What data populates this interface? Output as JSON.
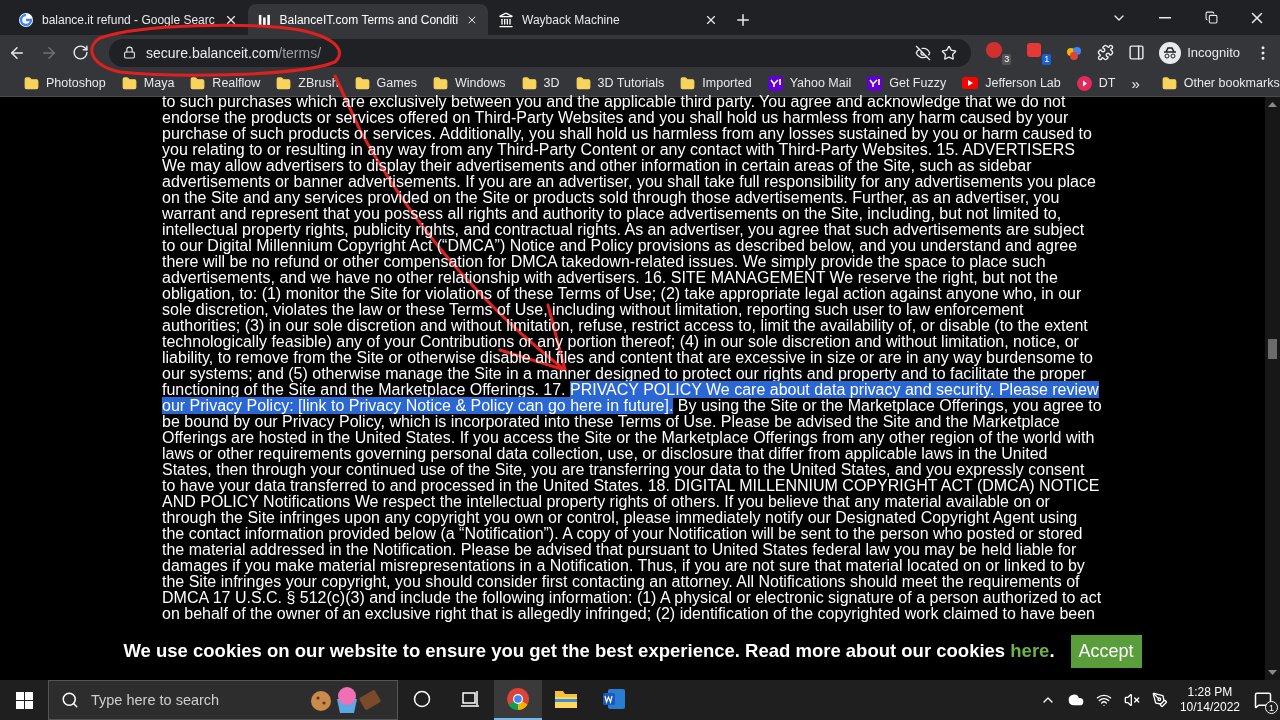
{
  "tabs": [
    {
      "title": "balance.it refund - Google Searc",
      "kind": "google",
      "selected": false
    },
    {
      "title": "BalanceIT.com Terms and Conditi",
      "kind": "bars",
      "selected": true
    },
    {
      "title": "Wayback Machine",
      "kind": "landmark",
      "selected": false
    }
  ],
  "toolbar": {
    "forward_disabled": true,
    "address_host": "secure.balanceit.com",
    "address_path": "/terms/",
    "extension_badges": [
      "3",
      "1"
    ],
    "profile": "Incognito"
  },
  "bookmarks": [
    {
      "label": "Photoshop",
      "kind": "folder"
    },
    {
      "label": "Maya",
      "kind": "folder"
    },
    {
      "label": "Realflow",
      "kind": "folder"
    },
    {
      "label": "ZBrush",
      "kind": "folder"
    },
    {
      "label": "Games",
      "kind": "folder"
    },
    {
      "label": "Windows",
      "kind": "folder"
    },
    {
      "label": "3D",
      "kind": "folder"
    },
    {
      "label": "3D Tutorials",
      "kind": "folder"
    },
    {
      "label": "Imported",
      "kind": "folder"
    },
    {
      "label": "Yahoo Mail",
      "kind": "yahoo"
    },
    {
      "label": "Get Fuzzy",
      "kind": "yahoo"
    },
    {
      "label": "Jefferson Lab",
      "kind": "video"
    },
    {
      "label": "DT",
      "kind": "play"
    }
  ],
  "bookmarks_overflow": "»",
  "other_bookmarks": "Other bookmarks",
  "page_lines": [
    [
      {
        "text": "to such purchases which are exclusively between you and the applicable third party. You agree and acknowledge that we do not",
        "selected": false
      }
    ],
    [
      {
        "text": "endorse the products or services offered on Third-Party Websites and you shall hold us harmless from any harm caused by your",
        "selected": false
      }
    ],
    [
      {
        "text": "purchase of such products or services. Additionally, you shall hold us harmless from any losses sustained by you or harm caused to",
        "selected": false
      }
    ],
    [
      {
        "text": "you relating to or resulting in any way from any Third-Party Content or any contact with Third-Party Websites. 15. ADVERTISERS",
        "selected": false
      }
    ],
    [
      {
        "text": "We may allow advertisers to display their advertisements and other information in certain areas of the Site, such as sidebar",
        "selected": false
      }
    ],
    [
      {
        "text": "advertisements or banner advertisements. If you are an advertiser, you shall take full responsibility for any advertisements you place",
        "selected": false
      }
    ],
    [
      {
        "text": "on the Site and any services provided on the Site or products sold through those advertisements. Further, as an advertiser, you",
        "selected": false
      }
    ],
    [
      {
        "text": "warrant and represent that you possess all rights and authority to place advertisements on the Site, including, but not limited to,",
        "selected": false
      }
    ],
    [
      {
        "text": "intellectual property rights, publicity rights, and contractual rights. As an advertiser, you agree that such advertisements are subject",
        "selected": false
      }
    ],
    [
      {
        "text": "to our Digital Millennium Copyright Act (“DMCA”) Notice and Policy provisions as described below, and you understand and agree",
        "selected": false
      }
    ],
    [
      {
        "text": "there will be no refund or other compensation for DMCA takedown-related issues. We simply provide the space to place such",
        "selected": false
      }
    ],
    [
      {
        "text": "advertisements, and we have no other relationship with advertisers. 16. SITE MANAGEMENT We reserve the right, but not the",
        "selected": false
      }
    ],
    [
      {
        "text": "obligation, to: (1) monitor the Site for violations of these Terms of Use; (2) take appropriate legal action against anyone who, in our",
        "selected": false
      }
    ],
    [
      {
        "text": "sole discretion, violates the law or these Terms of Use, including without limitation, reporting such user to law enforcement",
        "selected": false
      }
    ],
    [
      {
        "text": "authorities; (3) in our sole discretion and without limitation, refuse, restrict access to, limit the availability of, or disable (to the extent",
        "selected": false
      }
    ],
    [
      {
        "text": "technologically feasible) any of your Contributions or any portion thereof; (4) in our sole discretion and without limitation, notice, or",
        "selected": false
      }
    ],
    [
      {
        "text": "liability, to remove from the Site or otherwise disable all files and content that are excessive in size or are in any way burdensome to",
        "selected": false
      }
    ],
    [
      {
        "text": "our systems; and (5) otherwise manage the Site in a manner designed to protect our rights and property and to facilitate the proper",
        "selected": false
      }
    ],
    [
      {
        "text": "functioning of the Site and the Marketplace Offerings. 17. ",
        "selected": false
      },
      {
        "text": "PRIVACY POLICY We care about data privacy and security. Please review",
        "selected": true
      }
    ],
    [
      {
        "text": "our Privacy Policy: [link to Privacy Notice & Policy can go here in future].",
        "selected": true
      },
      {
        "text": " By using the Site or the Marketplace Offerings, you agree to",
        "selected": false
      }
    ],
    [
      {
        "text": "be bound by our Privacy Policy, which is incorporated into these Terms of Use. Please be advised the Site and the Marketplace",
        "selected": false
      }
    ],
    [
      {
        "text": "Offerings are hosted in the United States. If you access the Site or the Marketplace Offerings from any other region of the world with",
        "selected": false
      }
    ],
    [
      {
        "text": "laws or other requirements governing personal data collection, use, or disclosure that differ from applicable laws in the United",
        "selected": false
      }
    ],
    [
      {
        "text": "States, then through your continued use of the Site, you are transferring your data to the United States, and you expressly consent",
        "selected": false
      }
    ],
    [
      {
        "text": "to have your data transferred to and processed in the United States. 18. DIGITAL MILLENNIUM COPYRIGHT ACT (DMCA) NOTICE",
        "selected": false
      }
    ],
    [
      {
        "text": "AND POLICY Notifications We respect the intellectual property rights of others. If you believe that any material available on or",
        "selected": false
      }
    ],
    [
      {
        "text": "through the Site infringes upon any copyright you own or control, please immediately notify our Designated Copyright Agent using",
        "selected": false
      }
    ],
    [
      {
        "text": "the contact information provided below (a “Notification”). A copy of your Notification will be sent to the person who posted or stored",
        "selected": false
      }
    ],
    [
      {
        "text": "the material addressed in the Notification. Please be advised that pursuant to United States federal law you may be held liable for",
        "selected": false
      }
    ],
    [
      {
        "text": "damages if you make material misrepresentations in a Notification. Thus, if you are not sure that material located on or linked to by",
        "selected": false
      }
    ],
    [
      {
        "text": "the Site infringes your copyright, you should consider first contacting an attorney. All Notifications should meet the requirements of",
        "selected": false
      }
    ],
    [
      {
        "text": "DMCA 17 U.S.C. § 512(c)(3) and include the following information: (1) A physical or electronic signature of a person authorized to act",
        "selected": false
      }
    ],
    [
      {
        "text": "on behalf of the owner of an exclusive right that is allegedly infringed; (2) identification of the copyrighted work claimed to have been",
        "selected": false
      }
    ]
  ],
  "cookie_banner": {
    "text": "We use cookies on our website to ensure you get the best experience. Read more about our cookies",
    "link": "here",
    "end": ".",
    "button": "Accept"
  },
  "taskbar": {
    "search_placeholder": "Type here to search",
    "time": "1:28 PM",
    "date": "10/14/2022",
    "notification_count": "1"
  }
}
